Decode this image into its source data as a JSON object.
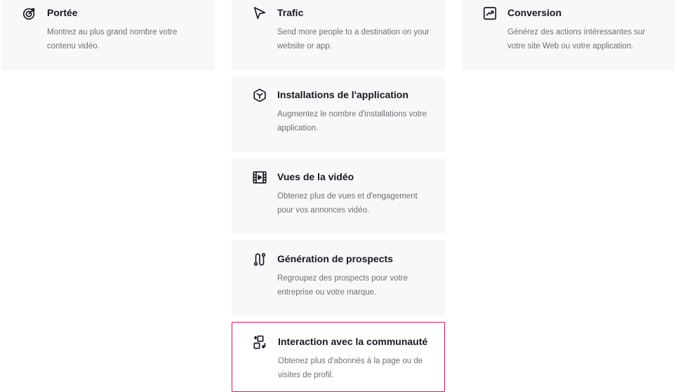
{
  "objectives": [
    {
      "title": "Portée",
      "description": "Montrez au plus grand nombre votre contenu vidéo.",
      "icon": "target-icon"
    },
    {
      "title": "Trafic",
      "description": "Send more people to a destination on your website or app.",
      "icon": "cursor-arrow-icon"
    },
    {
      "title": "Conversion",
      "description": "Générez des actions intéressantes sur votre site Web ou votre application.",
      "icon": "trending-chart-icon"
    },
    {
      "title": "Installations de l'application",
      "description": "Augmentez le nombre d'installations votre application.",
      "icon": "cube-icon"
    },
    {
      "title": "Vues de la vidéo",
      "description": "Obtenez plus de vues et d'engagement pour vos annonces vidéo.",
      "icon": "film-icon"
    },
    {
      "title": "Génération de prospects",
      "description": "Regroupez des prospects pour votre entreprise ou votre marque.",
      "icon": "path-icon"
    },
    {
      "title": "Interaction avec la communauté",
      "description": "Obtenez plus d'abonnés à la page ou de visites de profil.",
      "icon": "community-exchange-icon",
      "selected": true
    }
  ],
  "colors": {
    "card_bg": "#f8f8f8",
    "selected_border": "#e0115f",
    "title": "#161823",
    "description": "#6f6f76"
  }
}
